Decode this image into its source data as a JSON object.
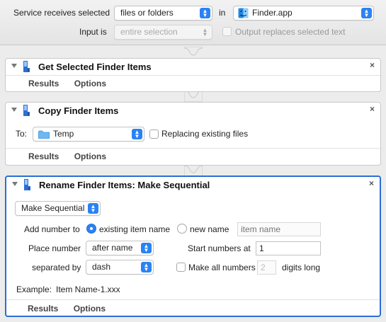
{
  "settings": {
    "service_receives_label": "Service receives selected",
    "input_type": "files or folders",
    "in_label": "in",
    "application": "Finder.app",
    "input_is_label": "Input is",
    "input_is_value": "entire selection",
    "output_replaces_label": "Output replaces selected text"
  },
  "actions": [
    {
      "title": "Get Selected Finder Items",
      "tabs": [
        "Results",
        "Options"
      ]
    },
    {
      "title": "Copy Finder Items",
      "to_label": "To:",
      "destination": "Temp",
      "replacing_label": "Replacing existing files",
      "tabs": [
        "Results",
        "Options"
      ]
    },
    {
      "title": "Rename Finder Items: Make Sequential",
      "mode": "Make Sequential",
      "add_number_to_label": "Add number to",
      "existing_item_name_label": "existing item name",
      "new_name_label": "new name",
      "new_name_placeholder": "item name",
      "place_number_label": "Place number",
      "place_number_value": "after name",
      "start_numbers_label": "Start numbers at",
      "start_numbers_value": "1",
      "separated_by_label": "separated by",
      "separator_value": "dash",
      "make_all_numbers_label": "Make all numbers",
      "digits_value": "2",
      "digits_long_label": "digits long",
      "example_label": "Example:",
      "example_value": "Item Name-1.xxx",
      "tabs": [
        "Results",
        "Options"
      ]
    }
  ],
  "close_glyph": "×",
  "colors": {
    "accent": "#2a82f6",
    "selected_border": "#2b6fd4"
  }
}
